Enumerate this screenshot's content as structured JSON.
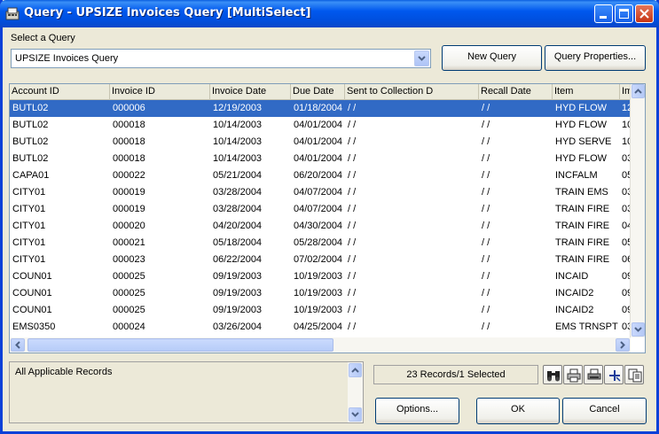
{
  "window": {
    "title": "Query - UPSIZE Invoices Query  [MultiSelect]",
    "title_icon": "query-app-icon"
  },
  "query": {
    "label": "Select a Query",
    "selected": "UPSIZE Invoices Query",
    "new_query_label": "New Query",
    "properties_label": "Query Properties..."
  },
  "grid": {
    "columns": [
      "Account ID",
      "Invoice ID",
      "Invoice Date",
      "Due Date",
      "Sent to Collection D",
      "Recall Date",
      "Item",
      "Im"
    ],
    "rows": [
      [
        "BUTL02",
        "000006",
        "12/19/2003",
        "01/18/2004",
        " /  /",
        " /  /",
        "HYD FLOW",
        "12"
      ],
      [
        "BUTL02",
        "000018",
        "10/14/2003",
        "04/01/2004",
        " /  /",
        " /  /",
        "HYD FLOW",
        "10"
      ],
      [
        "BUTL02",
        "000018",
        "10/14/2003",
        "04/01/2004",
        " /  /",
        " /  /",
        "HYD SERVE",
        "10"
      ],
      [
        "BUTL02",
        "000018",
        "10/14/2003",
        "04/01/2004",
        " /  /",
        " /  /",
        "HYD FLOW",
        "03"
      ],
      [
        "CAPA01",
        "000022",
        "05/21/2004",
        "06/20/2004",
        " /  /",
        " /  /",
        "INCFALM",
        "05"
      ],
      [
        "CITY01",
        "000019",
        "03/28/2004",
        "04/07/2004",
        " /  /",
        " /  /",
        "TRAIN EMS",
        "03"
      ],
      [
        "CITY01",
        "000019",
        "03/28/2004",
        "04/07/2004",
        " /  /",
        " /  /",
        "TRAIN FIRE",
        "03"
      ],
      [
        "CITY01",
        "000020",
        "04/20/2004",
        "04/30/2004",
        " /  /",
        " /  /",
        "TRAIN FIRE",
        "04"
      ],
      [
        "CITY01",
        "000021",
        "05/18/2004",
        "05/28/2004",
        " /  /",
        " /  /",
        "TRAIN FIRE",
        "05"
      ],
      [
        "CITY01",
        "000023",
        "06/22/2004",
        "07/02/2004",
        " /  /",
        " /  /",
        "TRAIN FIRE",
        "06"
      ],
      [
        "COUN01",
        "000025",
        "09/19/2003",
        "10/19/2003",
        " /  /",
        " /  /",
        "INCAID",
        "09"
      ],
      [
        "COUN01",
        "000025",
        "09/19/2003",
        "10/19/2003",
        " /  /",
        " /  /",
        "INCAID2",
        "09"
      ],
      [
        "COUN01",
        "000025",
        "09/19/2003",
        "10/19/2003",
        " /  /",
        " /  /",
        "INCAID2",
        "09"
      ],
      [
        "EMS0350",
        "000024",
        "03/26/2004",
        "04/25/2004",
        " /  /",
        " /  /",
        "EMS TRNSPT",
        "03"
      ]
    ],
    "selected_row": 0
  },
  "description": {
    "text": "All Applicable Records"
  },
  "status": {
    "text": "23 Records/1 Selected"
  },
  "tool_icons": [
    "binoculars-icon",
    "print-icon",
    "print-setup-icon",
    "crosshair-icon",
    "copy-icon"
  ],
  "buttons": {
    "options_label": "Options...",
    "ok_label": "OK",
    "cancel_label": "Cancel"
  },
  "colors": {
    "selection": "#316ac5",
    "titlebar": "#0058ee"
  }
}
